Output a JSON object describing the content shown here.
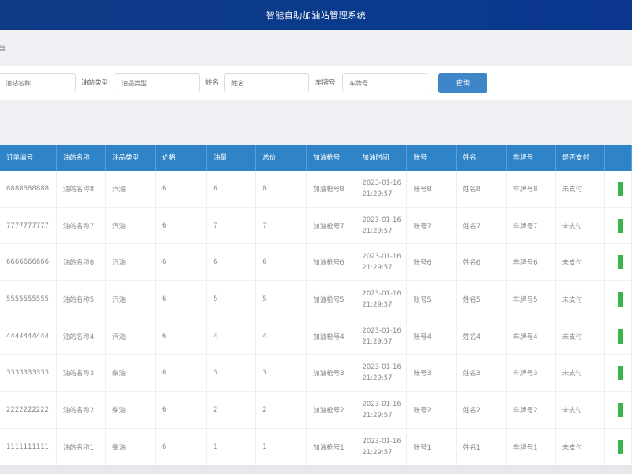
{
  "header": {
    "title": "智能自助加油站管理系统"
  },
  "breadcrumb": {
    "text": "单"
  },
  "search": {
    "station_placeholder": "油站名称",
    "type_label": "油站类型",
    "type_placeholder": "油品类型",
    "name_label": "姓名",
    "name_placeholder": "姓名",
    "plate_label": "车牌号",
    "plate_placeholder": "车牌号",
    "query_button": "查询"
  },
  "table": {
    "columns": [
      "订单编号",
      "油站名称",
      "油品类型",
      "价格",
      "油量",
      "总价",
      "加油枪号",
      "加油时间",
      "账号",
      "姓名",
      "车牌号",
      "是否支付",
      ""
    ],
    "rows": [
      {
        "order": "8888888888",
        "station": "油站名称8",
        "type": "汽油",
        "price": "6",
        "amount": "8",
        "total": "8",
        "gun": "加油枪号8",
        "date": "2023-01-16",
        "time": "21:29:57",
        "account": "账号8",
        "name": "姓名8",
        "plate": "车牌号8",
        "paid": "未支付"
      },
      {
        "order": "7777777777",
        "station": "油站名称7",
        "type": "汽油",
        "price": "6",
        "amount": "7",
        "total": "7",
        "gun": "加油枪号7",
        "date": "2023-01-16",
        "time": "21:29:57",
        "account": "账号7",
        "name": "姓名7",
        "plate": "车牌号7",
        "paid": "未支付"
      },
      {
        "order": "6666666666",
        "station": "油站名称6",
        "type": "汽油",
        "price": "6",
        "amount": "6",
        "total": "6",
        "gun": "加油枪号6",
        "date": "2023-01-16",
        "time": "21:29:57",
        "account": "账号6",
        "name": "姓名6",
        "plate": "车牌号6",
        "paid": "未支付"
      },
      {
        "order": "5555555555",
        "station": "油站名称5",
        "type": "汽油",
        "price": "6",
        "amount": "5",
        "total": "5",
        "gun": "加油枪号5",
        "date": "2023-01-16",
        "time": "21:29:57",
        "account": "账号5",
        "name": "姓名5",
        "plate": "车牌号5",
        "paid": "未支付"
      },
      {
        "order": "4444444444",
        "station": "油站名称4",
        "type": "汽油",
        "price": "6",
        "amount": "4",
        "total": "4",
        "gun": "加油枪号4",
        "date": "2023-01-16",
        "time": "21:29:57",
        "account": "账号4",
        "name": "姓名4",
        "plate": "车牌号4",
        "paid": "未支付"
      },
      {
        "order": "3333333333",
        "station": "油站名称3",
        "type": "柴油",
        "price": "6",
        "amount": "3",
        "total": "3",
        "gun": "加油枪号3",
        "date": "2023-01-16",
        "time": "21:29:57",
        "account": "账号3",
        "name": "姓名3",
        "plate": "车牌号3",
        "paid": "未支付"
      },
      {
        "order": "2222222222",
        "station": "油站名称2",
        "type": "柴油",
        "price": "6",
        "amount": "2",
        "total": "2",
        "gun": "加油枪号2",
        "date": "2023-01-16",
        "time": "21:29:57",
        "account": "账号2",
        "name": "姓名2",
        "plate": "车牌号2",
        "paid": "未支付"
      },
      {
        "order": "1111111111",
        "station": "油站名称1",
        "type": "柴油",
        "price": "6",
        "amount": "1",
        "total": "1",
        "gun": "加油枪号1",
        "date": "2023-01-16",
        "time": "21:29:57",
        "account": "账号1",
        "name": "姓名1",
        "plate": "车牌号1",
        "paid": "未支付"
      }
    ]
  },
  "colors": {
    "header_bg": "#0e3b86",
    "table_head": "#2f84c7",
    "button": "#3f86c8",
    "action_green": "#3cb44b"
  }
}
